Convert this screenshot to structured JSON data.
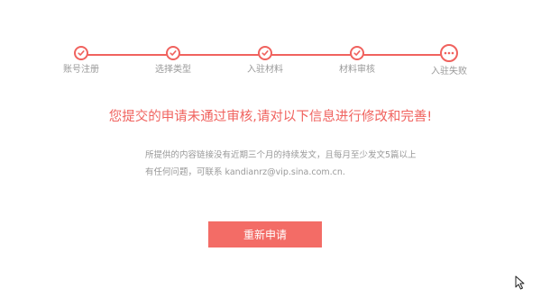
{
  "colors": {
    "accent": "#f0625e",
    "button": "#f36c66",
    "muted_text": "#999999"
  },
  "stepper": {
    "steps": [
      {
        "label": "账号注册",
        "state": "done",
        "icon": "check-icon"
      },
      {
        "label": "选择类型",
        "state": "done",
        "icon": "check-icon"
      },
      {
        "label": "入驻材料",
        "state": "done",
        "icon": "check-icon"
      },
      {
        "label": "材料审核",
        "state": "done",
        "icon": "check-icon"
      },
      {
        "label": "入驻失败",
        "state": "current",
        "icon": "more-dots-icon"
      }
    ]
  },
  "result": {
    "headline": "您提交的申请未通过审核,请对以下信息进行修改和完善!",
    "detail_line1": "所提供的内容链接没有近期三个月的持续发文，且每月至少发文5篇以上",
    "detail_line2": "有任何问题，可联系 kandianrz@vip.sina.com.cn."
  },
  "actions": {
    "reapply_label": "重新申请"
  }
}
